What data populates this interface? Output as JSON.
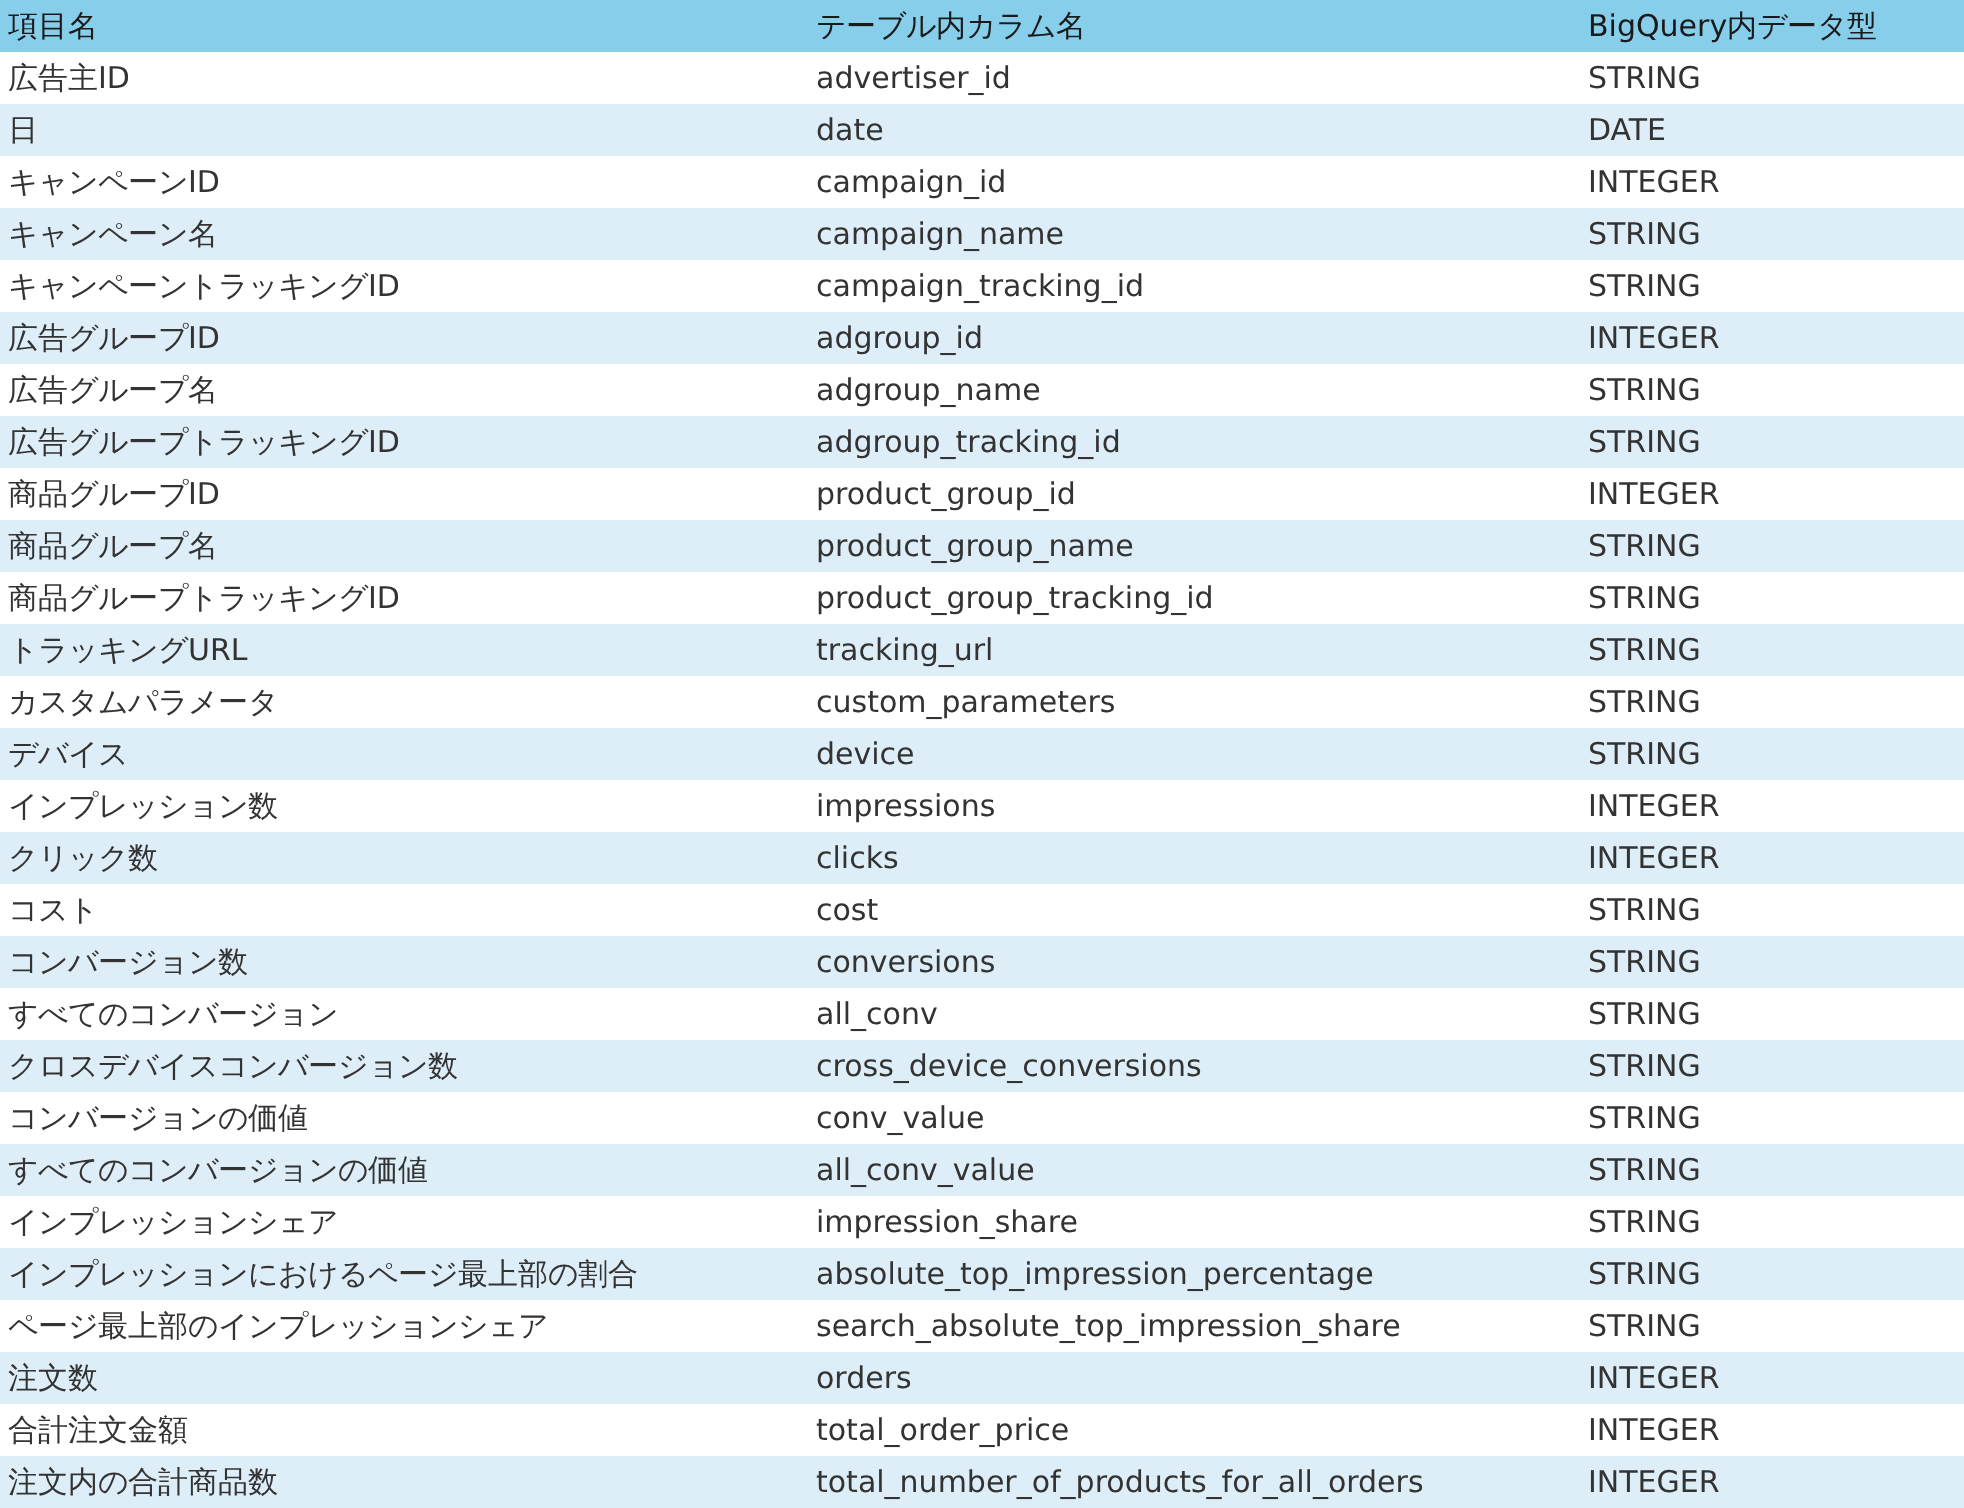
{
  "table": {
    "columns": [
      "項目名",
      "テーブル内カラム名",
      "BigQuery内データ型"
    ],
    "rows": [
      [
        "広告主ID",
        "advertiser_id",
        "STRING"
      ],
      [
        "日",
        "date",
        "DATE"
      ],
      [
        "キャンペーンID",
        "campaign_id",
        "INTEGER"
      ],
      [
        "キャンペーン名",
        "campaign_name",
        "STRING"
      ],
      [
        "キャンペーントラッキングID",
        "campaign_tracking_id",
        "STRING"
      ],
      [
        "広告グループID",
        "adgroup_id",
        "INTEGER"
      ],
      [
        "広告グループ名",
        "adgroup_name",
        "STRING"
      ],
      [
        "広告グループトラッキングID",
        "adgroup_tracking_id",
        "STRING"
      ],
      [
        "商品グループID",
        "product_group_id",
        "INTEGER"
      ],
      [
        "商品グループ名",
        "product_group_name",
        "STRING"
      ],
      [
        "商品グループトラッキングID",
        "product_group_tracking_id",
        "STRING"
      ],
      [
        "トラッキングURL",
        "tracking_url",
        "STRING"
      ],
      [
        "カスタムパラメータ",
        "custom_parameters",
        "STRING"
      ],
      [
        "デバイス",
        "device",
        "STRING"
      ],
      [
        "インプレッション数",
        "impressions",
        "INTEGER"
      ],
      [
        "クリック数",
        "clicks",
        "INTEGER"
      ],
      [
        "コスト",
        "cost",
        "STRING"
      ],
      [
        "コンバージョン数",
        "conversions",
        "STRING"
      ],
      [
        "すべてのコンバージョン",
        "all_conv",
        "STRING"
      ],
      [
        "クロスデバイスコンバージョン数",
        "cross_device_conversions",
        "STRING"
      ],
      [
        "コンバージョンの価値",
        "conv_value",
        "STRING"
      ],
      [
        "すべてのコンバージョンの価値",
        "all_conv_value",
        "STRING"
      ],
      [
        "インプレッションシェア",
        "impression_share",
        "STRING"
      ],
      [
        "インプレッションにおけるページ最上部の割合",
        "absolute_top_impression_percentage",
        "STRING"
      ],
      [
        "ページ最上部のインプレッションシェア",
        "search_absolute_top_impression_share",
        "STRING"
      ],
      [
        "注文数",
        "orders",
        "INTEGER"
      ],
      [
        "合計注文金額",
        "total_order_price",
        "INTEGER"
      ],
      [
        "注文内の合計商品数",
        "total_number_of_products_for_all_orders",
        "INTEGER"
      ]
    ]
  }
}
